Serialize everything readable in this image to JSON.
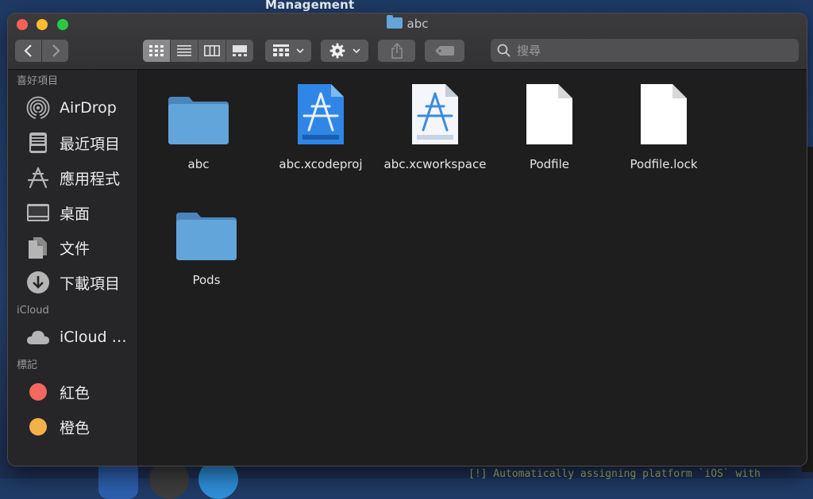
{
  "desktop": {
    "menubar_title": "Management",
    "terminal_line": "[!] Automatically assigning platform `iOS` with"
  },
  "window": {
    "title": "abc",
    "search": {
      "placeholder": "搜尋",
      "value": ""
    }
  },
  "toolbar": {
    "icons": [
      "back-chevron",
      "forward-chevron",
      "icon-view",
      "list-view",
      "column-view",
      "gallery-view",
      "group-by",
      "action-gear",
      "share",
      "tag"
    ]
  },
  "sidebar": {
    "sections": [
      {
        "title": "喜好項目",
        "items": [
          {
            "label": "AirDrop",
            "icon": "airdrop-icon"
          },
          {
            "label": "最近項目",
            "icon": "recents-icon"
          },
          {
            "label": "應用程式",
            "icon": "applications-icon"
          },
          {
            "label": "桌面",
            "icon": "desktop-icon"
          },
          {
            "label": "文件",
            "icon": "documents-icon"
          },
          {
            "label": "下載項目",
            "icon": "downloads-icon"
          }
        ]
      },
      {
        "title": "iCloud",
        "items": [
          {
            "label": "iCloud …",
            "icon": "cloud-icon"
          }
        ]
      },
      {
        "title": "標記",
        "items": [
          {
            "label": "紅色",
            "color": "#f5685e"
          },
          {
            "label": "橙色",
            "color": "#f6b04a"
          }
        ]
      }
    ]
  },
  "files": [
    {
      "name": "abc",
      "kind": "folder"
    },
    {
      "name": "abc.xcodeproj",
      "kind": "xcodeproj"
    },
    {
      "name": "abc.xcworkspace",
      "kind": "xcworkspace"
    },
    {
      "name": "Podfile",
      "kind": "document"
    },
    {
      "name": "Podfile.lock",
      "kind": "document"
    },
    {
      "name": "Pods",
      "kind": "folder"
    }
  ],
  "colors": {
    "folder": "#62a5da",
    "accent_blue": "#2f86e6",
    "close": "#fe5f57",
    "minimize": "#febc2e",
    "zoom": "#28c840"
  }
}
